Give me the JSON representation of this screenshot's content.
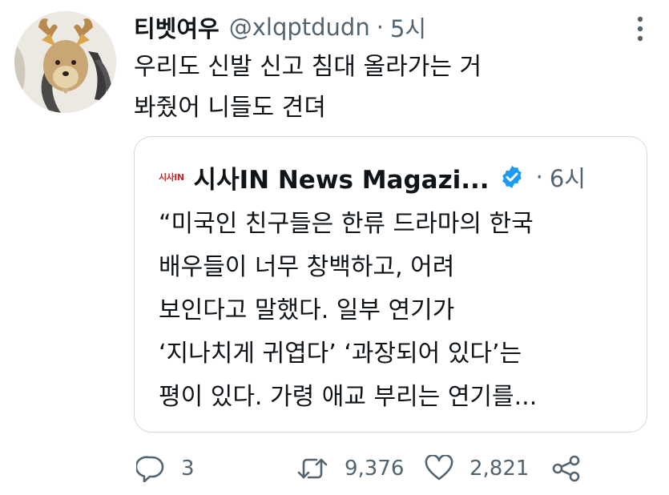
{
  "tweet": {
    "display_name": "티벳여우",
    "handle": "@xlqptdudn",
    "separator": "·",
    "time": "5시",
    "lines": [
      "우리도 신발 신고 침대 올라가는 거",
      "봐줬어 니들도 견뎌"
    ]
  },
  "quote": {
    "logo_text": "시사IN",
    "name": "시사IN News Magazi...",
    "separator": "·",
    "time": "6시",
    "lines": [
      "“미국인 친구들은 한류 드라마의 한국",
      "배우들이 너무 창백하고, 어려",
      "보인다고 말했다. 일부 연기가",
      "‘지나치게 귀엽다’ ‘과장되어 있다’는",
      "평이 있다. 가령 애교 부리는 연기를..."
    ]
  },
  "actions": {
    "reply_count": "3",
    "retweet_count": "9,376",
    "like_count": "2,821"
  },
  "icons": {
    "avatar": "fox-avatar-icon",
    "more": "more-icon",
    "verified": "verified-badge-icon",
    "reply": "reply-icon",
    "retweet": "retweet-icon",
    "like": "like-icon",
    "share": "share-icon"
  },
  "colors": {
    "text": "#0f1419",
    "secondary": "#536471",
    "border": "#cfd9de",
    "verified": "#1d9bf0"
  }
}
